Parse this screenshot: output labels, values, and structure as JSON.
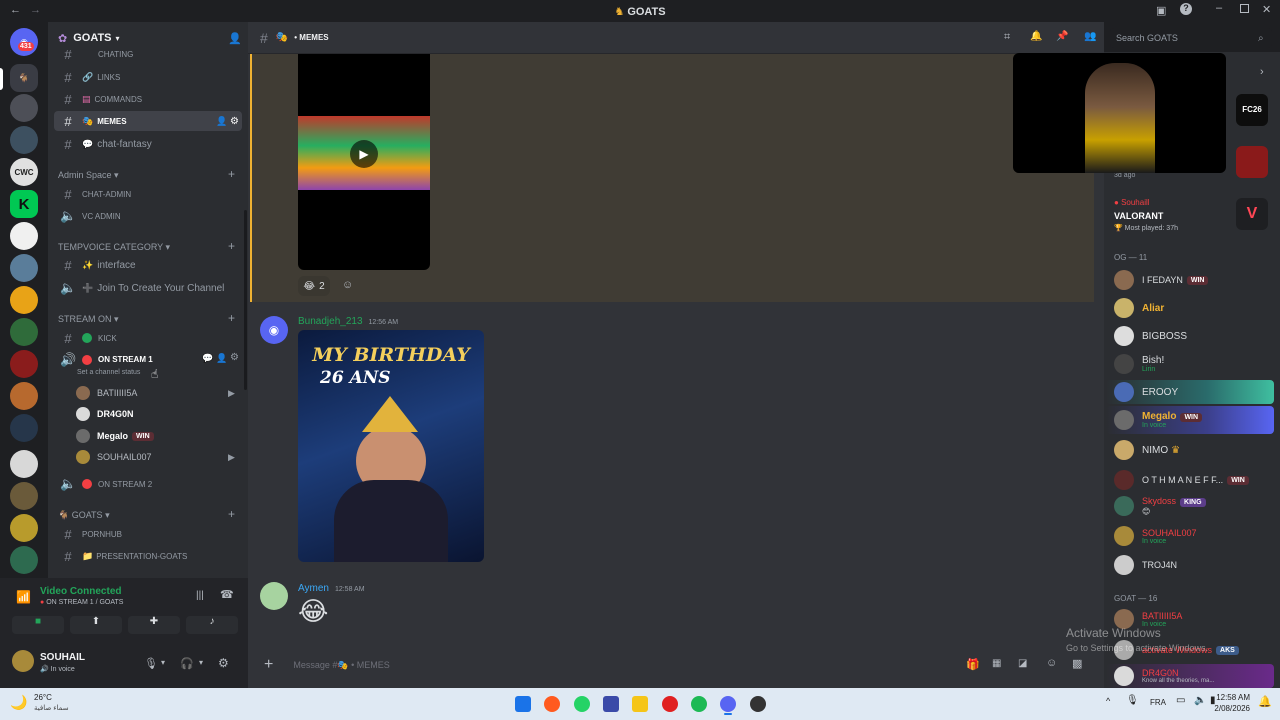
{
  "titlebar": {
    "title": "GOATS"
  },
  "guilds": {
    "badge": "431",
    "cwc": "CWC",
    "k": "K"
  },
  "server": {
    "name": "GOATS"
  },
  "channels": [
    {
      "label": "CHATING"
    },
    {
      "label": "LINKS"
    },
    {
      "label": "COMMANDS"
    },
    {
      "label": "MEMES"
    },
    {
      "label": "chat-fantasy"
    }
  ],
  "admin": {
    "category": "Admin Space",
    "chat": "CHAT-ADMIN",
    "vc": "VC ADMIN"
  },
  "tempvoice": {
    "category": "TEMPVOICE CATEGORY",
    "interface": "interface",
    "join": "Join To Create Your Channel"
  },
  "streamon": {
    "category": "STREAM ON",
    "kick": "KICK",
    "stream1": "ON STREAM 1",
    "status_hint": "Set a channel status",
    "users": [
      {
        "name": "BATIIIII5A"
      },
      {
        "name": "DR4G0N"
      },
      {
        "name": "Megalo",
        "badge": "WIN"
      },
      {
        "name": "SOUHAIL007"
      }
    ],
    "stream2": "ON STREAM 2"
  },
  "goats_cat": {
    "category": "GOATS",
    "ch1": "PORNHUB",
    "ch2": "PRESENTATION-GOATS"
  },
  "voice_panel": {
    "status": "Video Connected",
    "channel": "ON STREAM 1 / GOATS"
  },
  "user_panel": {
    "name": "SOUHAIL",
    "status": "In voice"
  },
  "main": {
    "channel": "MEMES",
    "search_placeholder": "Search GOATS",
    "reaction_count": "2",
    "msg1": {
      "author": "Bunadjeh_213",
      "time": "12:56 AM",
      "img_line1": "MY BIRTHDAY",
      "img_line2": "26 ANS"
    },
    "msg2": {
      "author": "Aymen",
      "time": "12:58 AM"
    },
    "composer_placeholder": "Message #",
    "composer_channel": "MEMES"
  },
  "members": {
    "activity_time": "3d ago",
    "activity_user": "Souhaill",
    "activity_game": "VALORANT",
    "activity_sub": "Most played: 37h",
    "og_header": "OG — 11",
    "og": [
      {
        "name": "I FEDAYN",
        "badge": "WIN"
      },
      {
        "name": "Aliar"
      },
      {
        "name": "BIGBOSS"
      },
      {
        "name": "Bish!",
        "sub": "Lirin"
      },
      {
        "name": "EROOY"
      },
      {
        "name": "Megalo",
        "badge": "WIN",
        "sub": "In voice"
      },
      {
        "name": "NIMO"
      },
      {
        "name": "O T H M A N E F F...",
        "badge": "WIN"
      },
      {
        "name": "Skydoss",
        "badge": "KING"
      },
      {
        "name": "SOUHAIL007",
        "sub": "In voice"
      },
      {
        "name": "TROJ4N"
      }
    ],
    "goat_header": "GOAT — 16",
    "goat": [
      {
        "name": "BATIIIII5A",
        "sub": "In voice"
      },
      {
        "name": "activate Windows",
        "badge": "AKS"
      },
      {
        "name": "DR4G0N",
        "sub": "Know all the theories, ma..."
      }
    ]
  },
  "watermark": {
    "line1": "Activate Windows",
    "line2": "Go to Settings to activate Windows."
  },
  "taskbar": {
    "temp": "26°C",
    "weather": "سماء صافية",
    "lang": "FRA",
    "time": "12:58 AM",
    "date": "2/08/2026"
  },
  "colors": {
    "accent": "#5865f2",
    "green": "#23a55a",
    "red": "#f23f43",
    "highlight": "#f0b232"
  }
}
